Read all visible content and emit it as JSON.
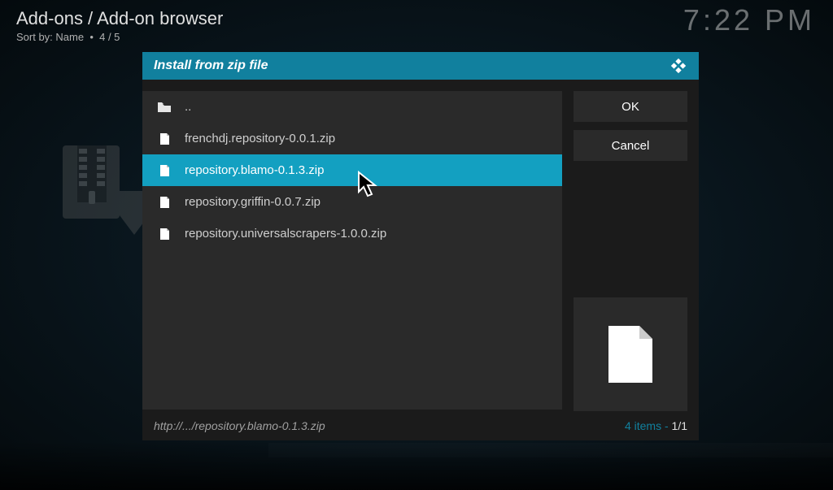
{
  "header": {
    "title": "Add-ons / Add-on browser",
    "sort_label": "Sort by: Name",
    "position": "4 / 5"
  },
  "clock": "7:22 PM",
  "dialog": {
    "title": "Install from zip file",
    "ok_label": "OK",
    "cancel_label": "Cancel",
    "path": "http://.../repository.blamo-0.1.3.zip",
    "items_count": "4 items",
    "page_indicator": "1/1",
    "rows": [
      {
        "type": "up",
        "label": "..",
        "selected": false
      },
      {
        "type": "file",
        "label": "frenchdj.repository-0.0.1.zip",
        "selected": false
      },
      {
        "type": "file",
        "label": "repository.blamo-0.1.3.zip",
        "selected": true
      },
      {
        "type": "file",
        "label": "repository.griffin-0.0.7.zip",
        "selected": false
      },
      {
        "type": "file",
        "label": "repository.universalscrapers-1.0.0.zip",
        "selected": false
      }
    ]
  }
}
